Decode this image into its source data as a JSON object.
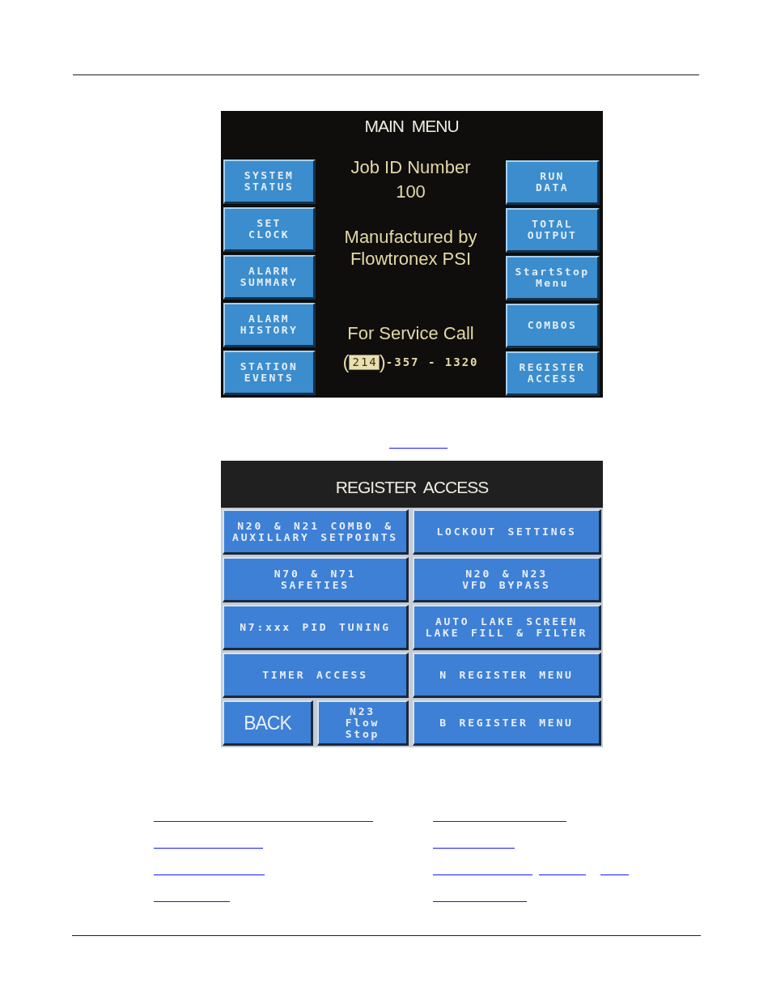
{
  "main_menu": {
    "title": "MAIN MENU",
    "left_buttons": [
      {
        "label": "SYSTEM\nSTATUS"
      },
      {
        "label": "SET\nCLOCK"
      },
      {
        "label": "ALARM\nSUMMARY"
      },
      {
        "label": "ALARM\nHISTORY"
      },
      {
        "label": "STATION\nEVENTS"
      }
    ],
    "job_id_label": "Job ID Number",
    "job_id": "100",
    "manufacturer_label": "Manufactured by",
    "manufacturer": "Flowtronex PSI",
    "service_label": "For Service Call",
    "phone": {
      "open": "(",
      "area_code": "214",
      "close": ")",
      "number": "-357 - 1320"
    },
    "right_buttons": [
      {
        "label": "RUN\nDATA"
      },
      {
        "label": "TOTAL\nOUTPUT"
      },
      {
        "label": "StartStop\nMenu"
      },
      {
        "label": "COMBOS"
      },
      {
        "label": "REGISTER\nACCESS"
      }
    ]
  },
  "register_access": {
    "title": "REGISTER ACCESS",
    "left_buttons": [
      {
        "kind": "menu",
        "label": "N20 & N21 COMBO &\nAUXILLARY SETPOINTS"
      },
      {
        "kind": "menu",
        "label": "N70 & N71\nSAFETIES"
      },
      {
        "kind": "menu",
        "label": "N7:xxx PID TUNING"
      },
      {
        "kind": "menu",
        "label": "TIMER ACCESS"
      }
    ],
    "bottom_left_buttons": [
      {
        "kind": "back",
        "label": "BACK"
      },
      {
        "kind": "menu",
        "label": "N23\nFlow\nStop"
      }
    ],
    "right_buttons": [
      {
        "kind": "menu",
        "label": "LOCKOUT SETTINGS"
      },
      {
        "kind": "menu",
        "label": "N20 & N23\nVFD BYPASS"
      },
      {
        "kind": "menu",
        "label": "AUTO LAKE SCREEN\nLAKE FILL & FILTER"
      },
      {
        "kind": "menu",
        "label": "N REGISTER MENU"
      },
      {
        "kind": "menu",
        "label": "B REGISTER MENU"
      }
    ]
  }
}
